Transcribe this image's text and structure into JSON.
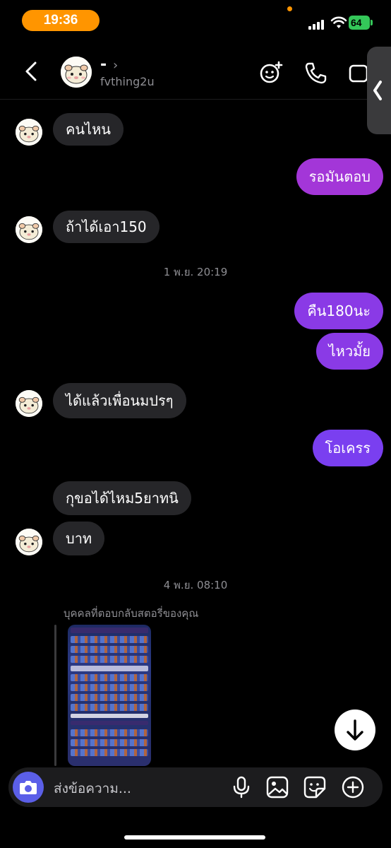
{
  "status_bar": {
    "time": "19:36",
    "battery": "64"
  },
  "header": {
    "name": "-",
    "username": "fvthing2u"
  },
  "messages": [
    {
      "text": "คนไหน"
    },
    {
      "text": "รอมันตอบ"
    },
    {
      "text": "ถ้าได้เอา150"
    },
    {
      "text": "คืน180นะ"
    },
    {
      "text": "ไหวมั้ย"
    },
    {
      "text": "ได้แล้วเพื่อนมปรๆ"
    },
    {
      "text": "โอเครร"
    },
    {
      "text": "กุขอได้ไหม5ยาทนิ"
    },
    {
      "text": "บาท"
    }
  ],
  "timestamps": [
    "1 พ.ย. 20:19",
    "4 พ.ย. 08:10"
  ],
  "story_reply": {
    "label": "บุคคลที่ตอบกลับสตอรี่ของคุณ"
  },
  "composer": {
    "placeholder": "ส่งข้อความ..."
  },
  "colors": {
    "incoming": "#262629",
    "outgoing_top": "#a336d8",
    "outgoing_bottom": "#7a3ff0",
    "time_pill": "#ff9500",
    "battery": "#34c759"
  },
  "icons": [
    "back-icon",
    "video-chat-icon",
    "phone-icon",
    "video-camera-icon",
    "camera-icon",
    "microphone-icon",
    "gallery-icon",
    "sticker-icon",
    "plus-icon",
    "arrow-down-icon"
  ]
}
